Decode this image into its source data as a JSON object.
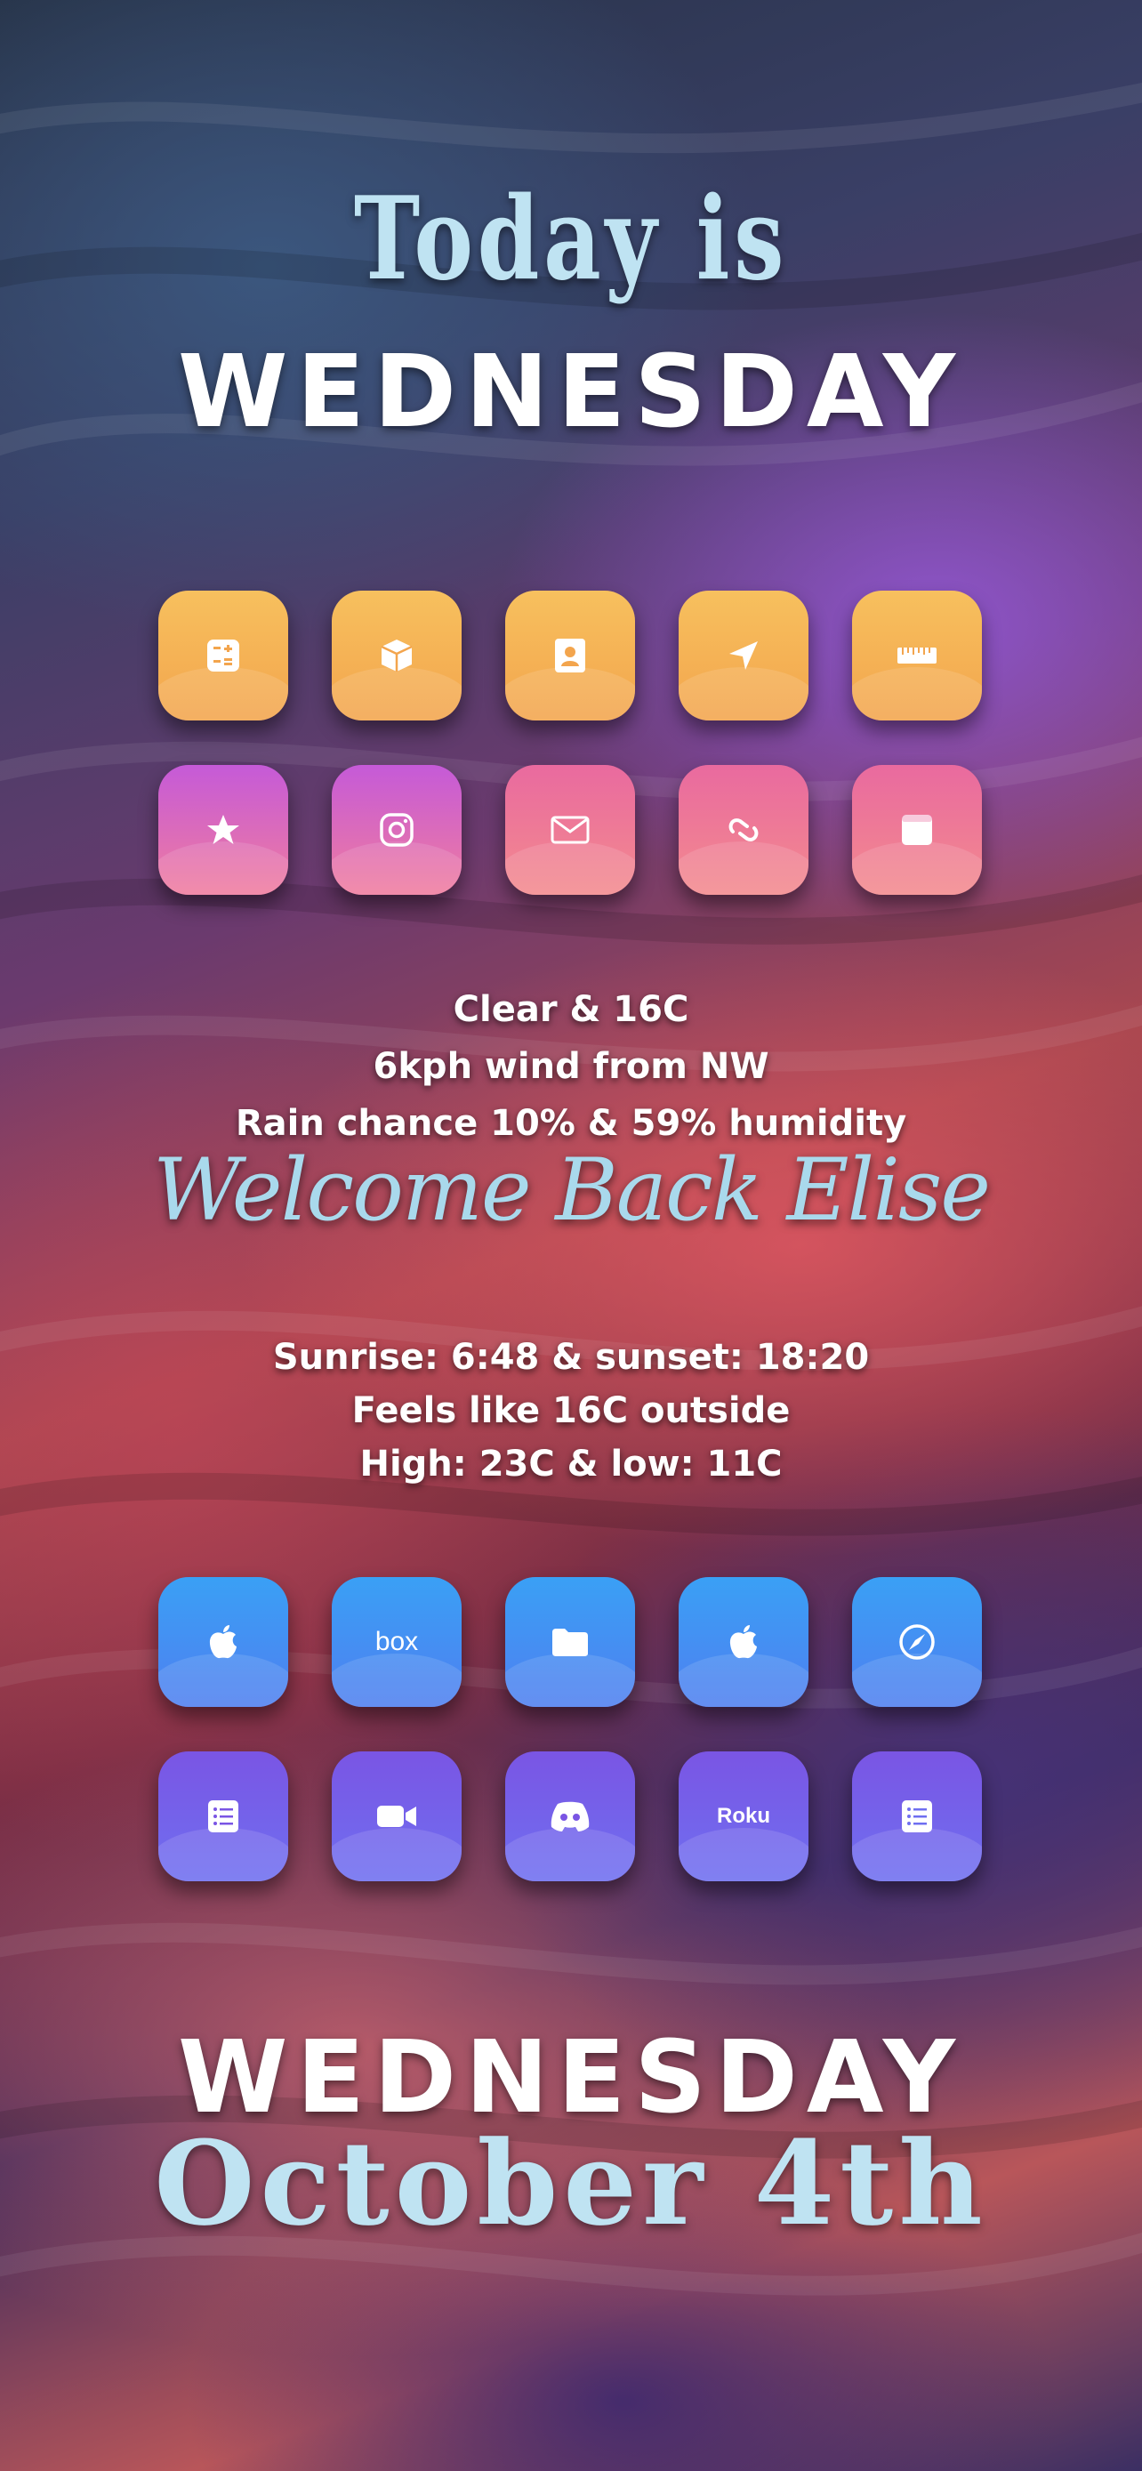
{
  "header": {
    "title": "Today is",
    "day_decorative": "WEDNESDAY"
  },
  "weather": {
    "line1": "Clear & 16C",
    "line2": "6kph wind from NW",
    "line3": "Rain chance 10% & 59% humidity"
  },
  "welcome": "Welcome Back Elise",
  "sun": {
    "line1": "Sunrise: 6:48 & sunset: 18:20",
    "line2": "Feels like 16C outside",
    "line3": "High: 23C & low: 11C"
  },
  "footer": {
    "day_decorative": "WEDNESDAY",
    "date": "October 4th"
  },
  "apps_top_row1": [
    {
      "icon": "calculator-icon"
    },
    {
      "icon": "package-icon"
    },
    {
      "icon": "contacts-icon"
    },
    {
      "icon": "location-arrow-icon"
    },
    {
      "icon": "ruler-icon"
    }
  ],
  "apps_top_row2": [
    {
      "icon": "star-icon"
    },
    {
      "icon": "instagram-icon"
    },
    {
      "icon": "mail-icon"
    },
    {
      "icon": "link-icon"
    },
    {
      "icon": "calendar-icon"
    }
  ],
  "apps_bottom_row1": [
    {
      "icon": "apple-icon"
    },
    {
      "icon": "box-icon",
      "label": "box"
    },
    {
      "icon": "folder-icon"
    },
    {
      "icon": "apple-icon"
    },
    {
      "icon": "safari-compass-icon"
    }
  ],
  "apps_bottom_row2": [
    {
      "icon": "list-icon"
    },
    {
      "icon": "video-camera-icon"
    },
    {
      "icon": "discord-icon"
    },
    {
      "icon": "roku-icon",
      "label": "Roku"
    },
    {
      "icon": "notes-icon"
    }
  ],
  "colors": {
    "accent_light_blue": "#bfe3f2",
    "orange_icon": "#f5b156",
    "pink_icon": "#e96a9f",
    "blue_icon": "#3f8ff2",
    "violet_icon": "#7a55e4"
  }
}
